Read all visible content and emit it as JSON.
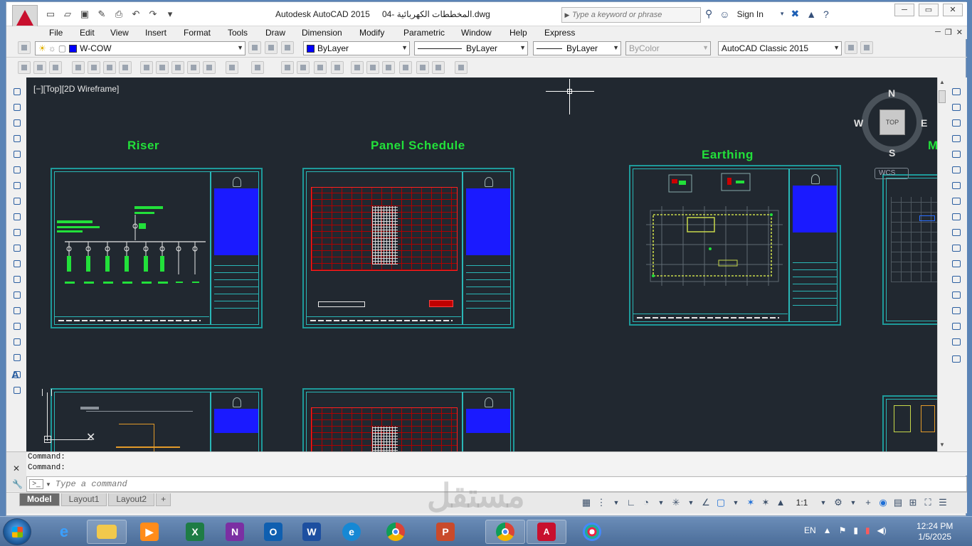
{
  "app": {
    "title": "Autodesk AutoCAD 2015",
    "file_name": "04- المخططات الكهربائية.dwg",
    "search_placeholder": "Type a keyword or phrase",
    "sign_in": "Sign In"
  },
  "menu": [
    "File",
    "Edit",
    "View",
    "Insert",
    "Format",
    "Tools",
    "Draw",
    "Dimension",
    "Modify",
    "Parametric",
    "Window",
    "Help",
    "Express"
  ],
  "properties": {
    "layer": "W-COW",
    "color": "ByLayer",
    "linetype": "ByLayer",
    "lineweight": "ByLayer",
    "plotstyle": "ByColor",
    "workspace": "AutoCAD Classic 2015",
    "accent_color": "#0000ff"
  },
  "viewport": {
    "label": "[−][Top][2D Wireframe]",
    "background": "#212830"
  },
  "sheets": {
    "riser_title": "Riser",
    "panel_title": "Panel Schedule",
    "earthing_title": "Earthing",
    "partial_title": "M",
    "title_color": "#22e03a",
    "frame_color": "#1e9a9a"
  },
  "viewcube": {
    "north": "N",
    "south": "S",
    "east": "E",
    "west": "W",
    "top": "TOP",
    "wcs": "WCS"
  },
  "command": {
    "history": [
      "Command:",
      "Command:"
    ],
    "placeholder": "Type a command"
  },
  "layout_tabs": [
    "Model",
    "Layout1",
    "Layout2"
  ],
  "status": {
    "annotation_scale": "1:1"
  },
  "watermark": "مستقل",
  "taskbar": {
    "language": "EN",
    "time": "12:24 PM",
    "date": "1/5/2025",
    "apps": [
      "internet-explorer",
      "file-explorer",
      "media-player",
      "excel",
      "onenote",
      "outlook",
      "word",
      "edge",
      "chrome",
      "powerpoint",
      "chrome-profile",
      "autocad",
      "paint"
    ]
  }
}
